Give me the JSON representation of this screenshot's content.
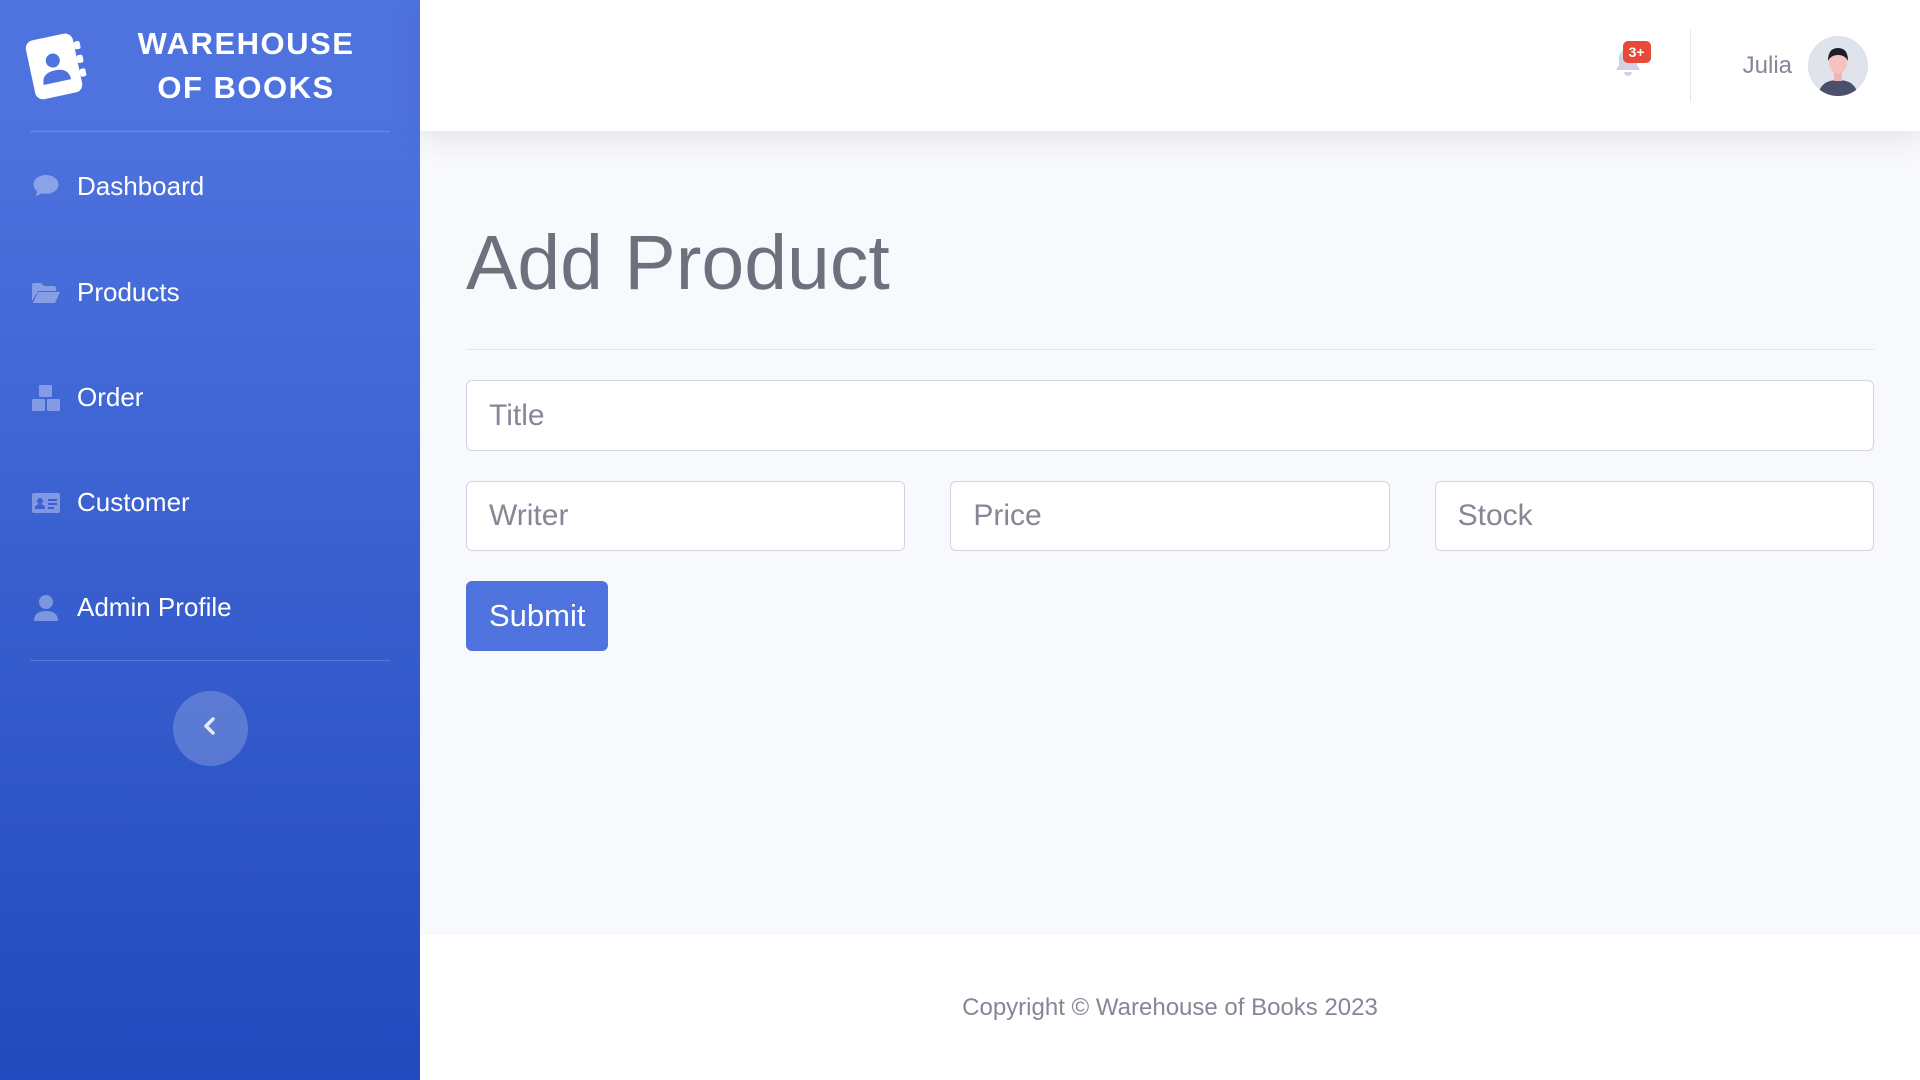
{
  "brand": {
    "line1": "WAREHOUSE",
    "line2": "OF BOOKS",
    "icon": "address-book-icon"
  },
  "sidebar": {
    "items": [
      {
        "label": "Dashboard",
        "icon": "comment-icon"
      },
      {
        "label": "Products",
        "icon": "folder-open-icon"
      },
      {
        "label": "Order",
        "icon": "boxes-icon"
      },
      {
        "label": "Customer",
        "icon": "id-card-icon"
      },
      {
        "label": "Admin Profile",
        "icon": "user-icon"
      }
    ],
    "toggle_icon": "chevron-left-icon"
  },
  "topbar": {
    "notification_count": "3+",
    "user_name": "Julia"
  },
  "page": {
    "title": "Add Product",
    "form": {
      "title_placeholder": "Title",
      "writer_placeholder": "Writer",
      "price_placeholder": "Price",
      "stock_placeholder": "Stock",
      "submit_label": "Submit"
    }
  },
  "footer": {
    "copyright": "Copyright © Warehouse of Books 2023"
  },
  "colors": {
    "sidebar_top": "#4e73df",
    "sidebar_bottom": "#224abe",
    "primary": "#4e73df",
    "badge": "#e74a3b",
    "text_muted": "#858796"
  }
}
